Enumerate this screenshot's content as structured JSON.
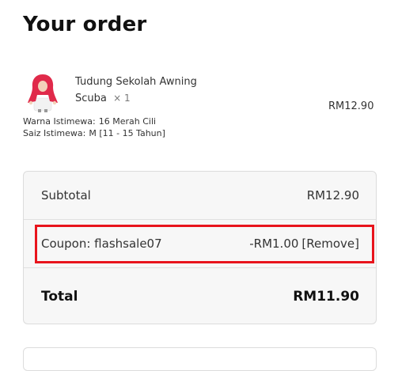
{
  "order": {
    "title": "Your order",
    "item": {
      "name": "Tudung Sekolah Awning Scuba",
      "qty": "× 1",
      "price": "RM12.90",
      "meta": [
        {
          "label": "Warna Istimewa:",
          "value": "16 Merah Cili"
        },
        {
          "label": "Saiz Istimewa:",
          "value": "M [11 - 15 Tahun]"
        }
      ],
      "thumb_icon": "product-thumbnail-girl-red-hijab"
    },
    "subtotal_label": "Subtotal",
    "subtotal_value": "RM12.90",
    "coupon_label": "Coupon: flashsale07",
    "coupon_value": "-RM1.00",
    "coupon_remove": "[Remove]",
    "total_label": "Total",
    "total_value": "RM11.90"
  },
  "colors": {
    "highlight": "#e8141c",
    "hijab": "#e02a4a"
  }
}
